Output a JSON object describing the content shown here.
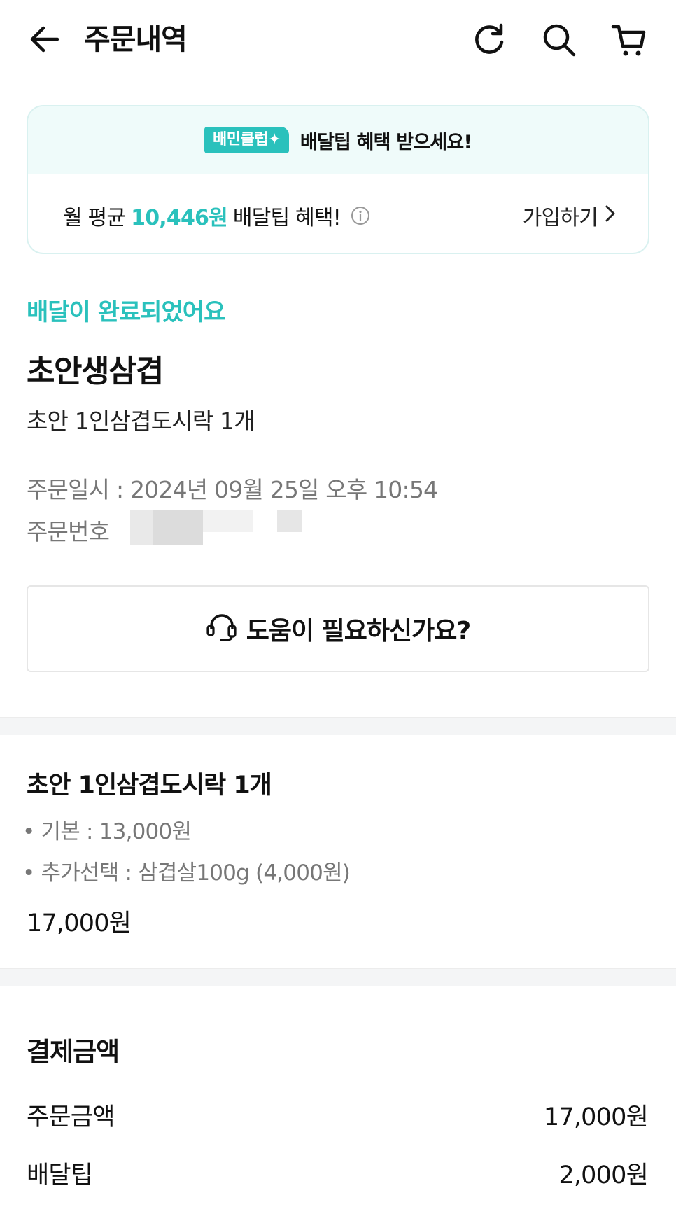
{
  "header": {
    "title": "주문내역",
    "icons": [
      "back-arrow-icon",
      "refresh-icon",
      "search-icon",
      "cart-icon"
    ]
  },
  "club_banner": {
    "badge": "배민클럽✦",
    "headline": "배달팁 혜택 받으세요!",
    "avg_prefix": "월 평균",
    "avg_amount": "10,446원",
    "avg_suffix": "배달팁 혜택!",
    "join_label": "가입하기",
    "accent_color": "#2ac1bc"
  },
  "order": {
    "status": "배달이 완료되었어요",
    "store_name": "초안생삼겹",
    "summary": "초안 1인삼겹도시락 1개",
    "date_label": "주문일시",
    "date_value": "2024년 09월 25일 오후 10:54",
    "number_label": "주문번호"
  },
  "help_button": {
    "label": "도움이 필요하신가요?"
  },
  "item": {
    "title": "초안 1인삼겹도시락 1개",
    "base_option": "• 기본 : 13,000원",
    "extra_option": "• 추가선택 : 삼겹살100g (4,000원)",
    "price": "17,000원"
  },
  "payment": {
    "title": "결제금액",
    "rows": [
      {
        "label": "주문금액",
        "value": "17,000원"
      },
      {
        "label": "배달팁",
        "value": "2,000원"
      }
    ]
  }
}
